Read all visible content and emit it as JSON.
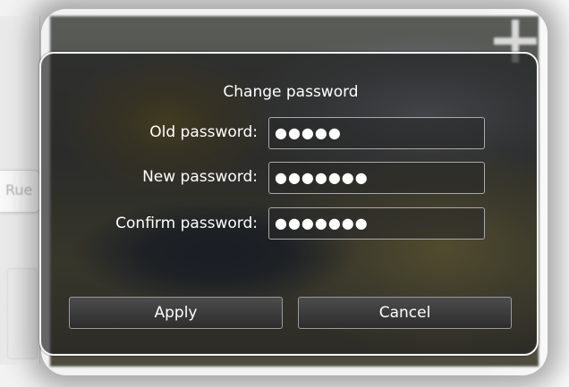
{
  "background": {
    "left_tab_text": "Rue"
  },
  "dialog": {
    "title": "Change password",
    "fields": [
      {
        "label": "Old password:",
        "value": "●●●●●"
      },
      {
        "label": "New password:",
        "value": "●●●●●●●"
      },
      {
        "label": "Confirm password:",
        "value": "●●●●●●●"
      }
    ],
    "buttons": {
      "apply": "Apply",
      "cancel": "Cancel"
    }
  },
  "icons": {
    "zoom_in": "plus-icon"
  },
  "colors": {
    "dialog_border": "#f4f4f4",
    "text": "#ffffff",
    "field_border": "#a9a9a9"
  }
}
